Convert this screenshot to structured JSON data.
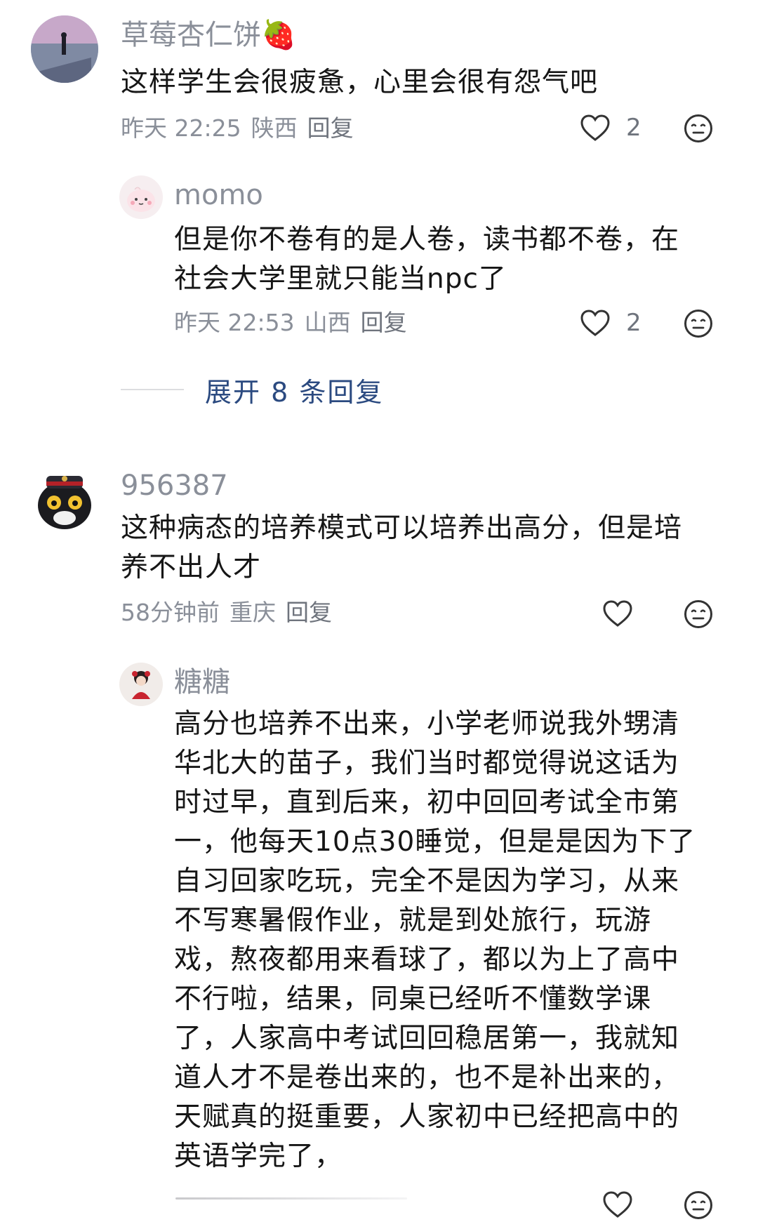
{
  "comments": [
    {
      "username": "草莓杏仁饼🍓",
      "text": "这样学生会很疲惫，心里会很有怨气吧",
      "time": "昨天 22:25",
      "location": "陕西",
      "reply_label": "回复",
      "likes": "2",
      "replies": [
        {
          "username": "momo",
          "text_lines": [
            "但是你不卷有的是人卷，读书都不卷，在",
            "社会大学里就只能当npc了"
          ],
          "time": "昨天 22:53",
          "location": "山西",
          "reply_label": "回复",
          "likes": "2"
        }
      ],
      "expand_label": "展开 8 条回复"
    },
    {
      "username": "956387",
      "text_lines": [
        "这种病态的培养模式可以培养出高分，但是培",
        "养不出人才"
      ],
      "time": "58分钟前",
      "location": "重庆",
      "reply_label": "回复",
      "likes": "",
      "replies": [
        {
          "username": "糖糖",
          "text_lines": [
            "高分也培养不出来，小学老师说我外甥清",
            "华北大的苗子，我们当时都觉得说这话为",
            "时过早，直到后来，初中回回考试全市第",
            "一，他每天10点30睡觉，但是是因为下了",
            "自习回家吃玩，完全不是因为学习，从来",
            "不写寒暑假作业，就是到处旅行，玩游",
            "戏，熬夜都用来看球了，都以为上了高中",
            "不行啦，结果，同桌已经听不懂数学课",
            "了，人家高中考试回回稳居第一，我就知",
            "道人才不是卷出来的，也不是补出来的，",
            "天赋真的挺重要，人家初中已经把高中的",
            "英语学完了，"
          ],
          "likes": ""
        }
      ]
    }
  ],
  "icons": {
    "like": "heart-outline-icon",
    "emoji": "neutral-face-icon"
  },
  "colors": {
    "username": "#8a8f99",
    "expand_link": "#2b4a80",
    "text": "#161616"
  }
}
